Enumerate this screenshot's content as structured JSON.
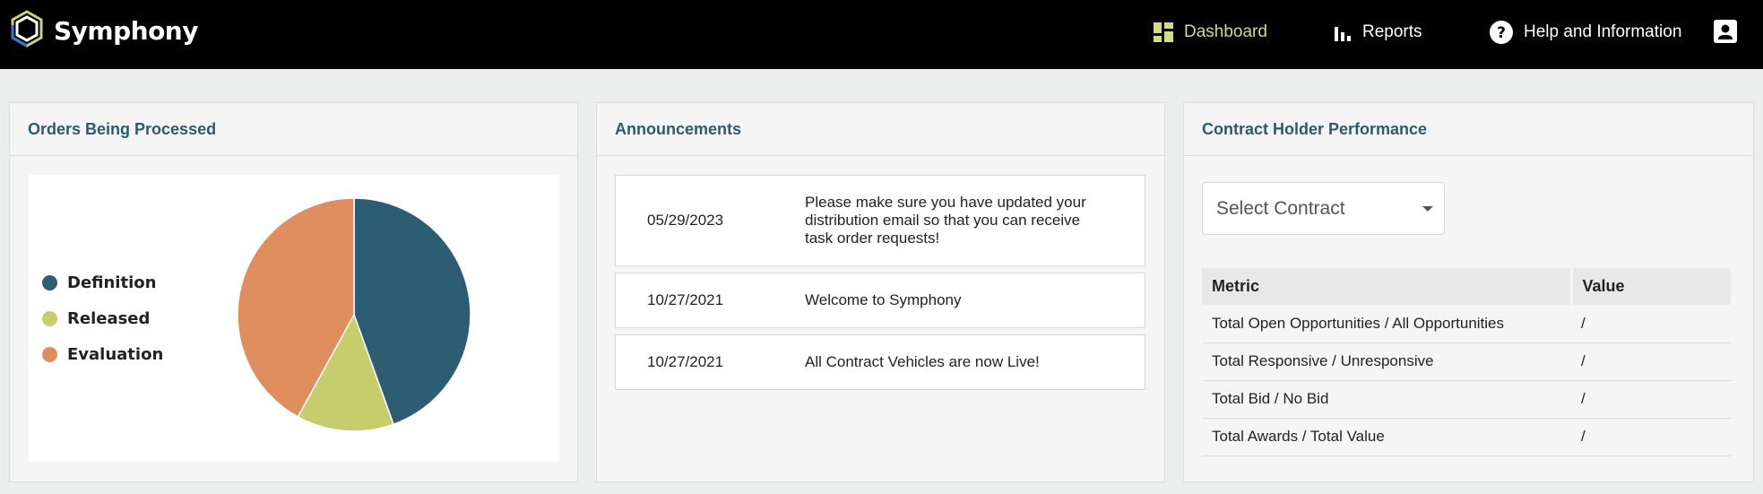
{
  "app": {
    "name": "Symphony"
  },
  "nav": {
    "dashboard": "Dashboard",
    "reports": "Reports",
    "help": "Help and Information"
  },
  "colors": {
    "accent": "#d3dd7d",
    "title": "#2c5a6e",
    "definition": "#2c5d72",
    "released": "#c5cd6c",
    "evaluation": "#e08e5d"
  },
  "orders": {
    "title": "Orders Being Processed",
    "legend": [
      {
        "label": "Definition",
        "color": "#2c5d72"
      },
      {
        "label": "Released",
        "color": "#c5cd6c"
      },
      {
        "label": "Evaluation",
        "color": "#e08e5d"
      }
    ]
  },
  "chart_data": {
    "type": "pie",
    "categories": [
      "Definition",
      "Released",
      "Evaluation"
    ],
    "values": [
      44.5,
      13.5,
      42
    ],
    "colors": [
      "#2c5d72",
      "#c5cd6c",
      "#e08e5d"
    ],
    "legend": "left"
  },
  "announcements": {
    "title": "Announcements",
    "items": [
      {
        "date": "05/29/2023",
        "text": "Please make sure you have updated your distribution email so that you can receive task order requests!"
      },
      {
        "date": "10/27/2021",
        "text": "Welcome to Symphony"
      },
      {
        "date": "10/27/2021",
        "text": "All Contract Vehicles are now Live!"
      }
    ]
  },
  "performance": {
    "title": "Contract Holder Performance",
    "select_placeholder": "Select Contract",
    "headers": {
      "metric": "Metric",
      "value": "Value"
    },
    "rows": [
      {
        "metric": "Total Open Opportunities / All Opportunities",
        "value": "/"
      },
      {
        "metric": "Total Responsive / Unresponsive",
        "value": "/"
      },
      {
        "metric": "Total Bid / No Bid",
        "value": "/"
      },
      {
        "metric": "Total Awards / Total Value",
        "value": "/"
      }
    ]
  }
}
